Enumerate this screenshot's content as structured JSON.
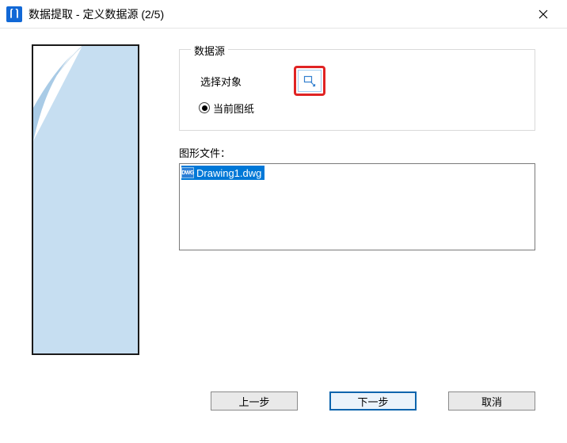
{
  "title": "数据提取 - 定义数据源 (2/5)",
  "datasource": {
    "legend": "数据源",
    "select_label": "选择对象",
    "radio_current": "当前图纸"
  },
  "files": {
    "label": "图形文件：",
    "items": [
      "Drawing1.dwg"
    ]
  },
  "buttons": {
    "back": "上一步",
    "next": "下一步",
    "cancel": "取消"
  }
}
